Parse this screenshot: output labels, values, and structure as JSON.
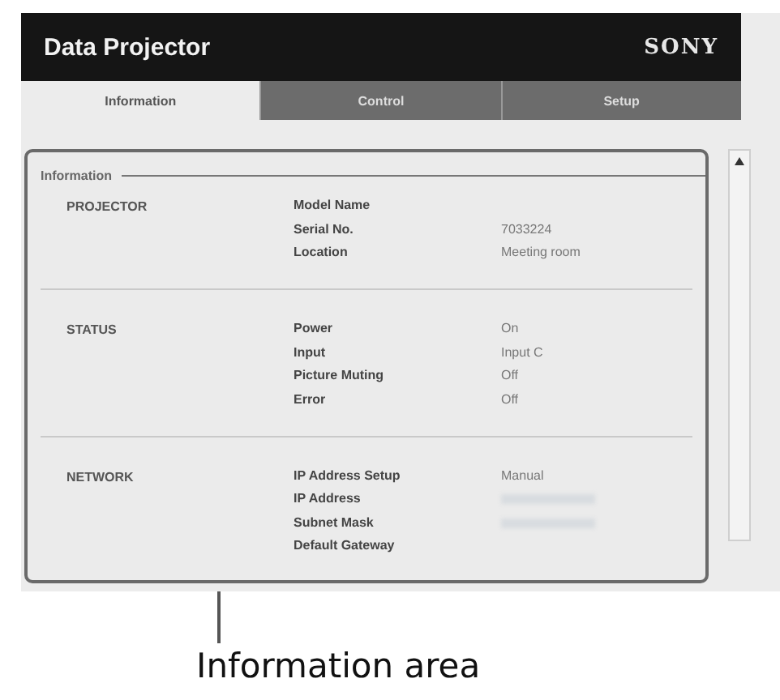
{
  "header": {
    "title": "Data Projector",
    "brand": "SONY"
  },
  "tabs": [
    {
      "label": "Information",
      "selected": true
    },
    {
      "label": "Control",
      "selected": false
    },
    {
      "label": "Setup",
      "selected": false
    }
  ],
  "panel": {
    "legend": "Information",
    "sections": [
      {
        "name": "PROJECTOR",
        "rows": [
          {
            "label": "Model Name"
          },
          {
            "label": "Serial No.",
            "value": "7033224"
          },
          {
            "label": "Location",
            "value": "Meeting room"
          }
        ]
      },
      {
        "name": "STATUS",
        "rows": [
          {
            "label": "Power",
            "value": "On"
          },
          {
            "label": "Input",
            "value": "Input C"
          },
          {
            "label": "Picture Muting",
            "value": "Off"
          },
          {
            "label": "Error",
            "value": "Off"
          }
        ]
      },
      {
        "name": "NETWORK",
        "rows": [
          {
            "label": "IP Address Setup",
            "value": "Manual"
          },
          {
            "label": "IP Address",
            "blurred": true
          },
          {
            "label": "Subnet Mask",
            "blurred": true
          },
          {
            "label": "Default Gateway"
          }
        ]
      }
    ]
  },
  "callout": {
    "label": "Information area"
  }
}
